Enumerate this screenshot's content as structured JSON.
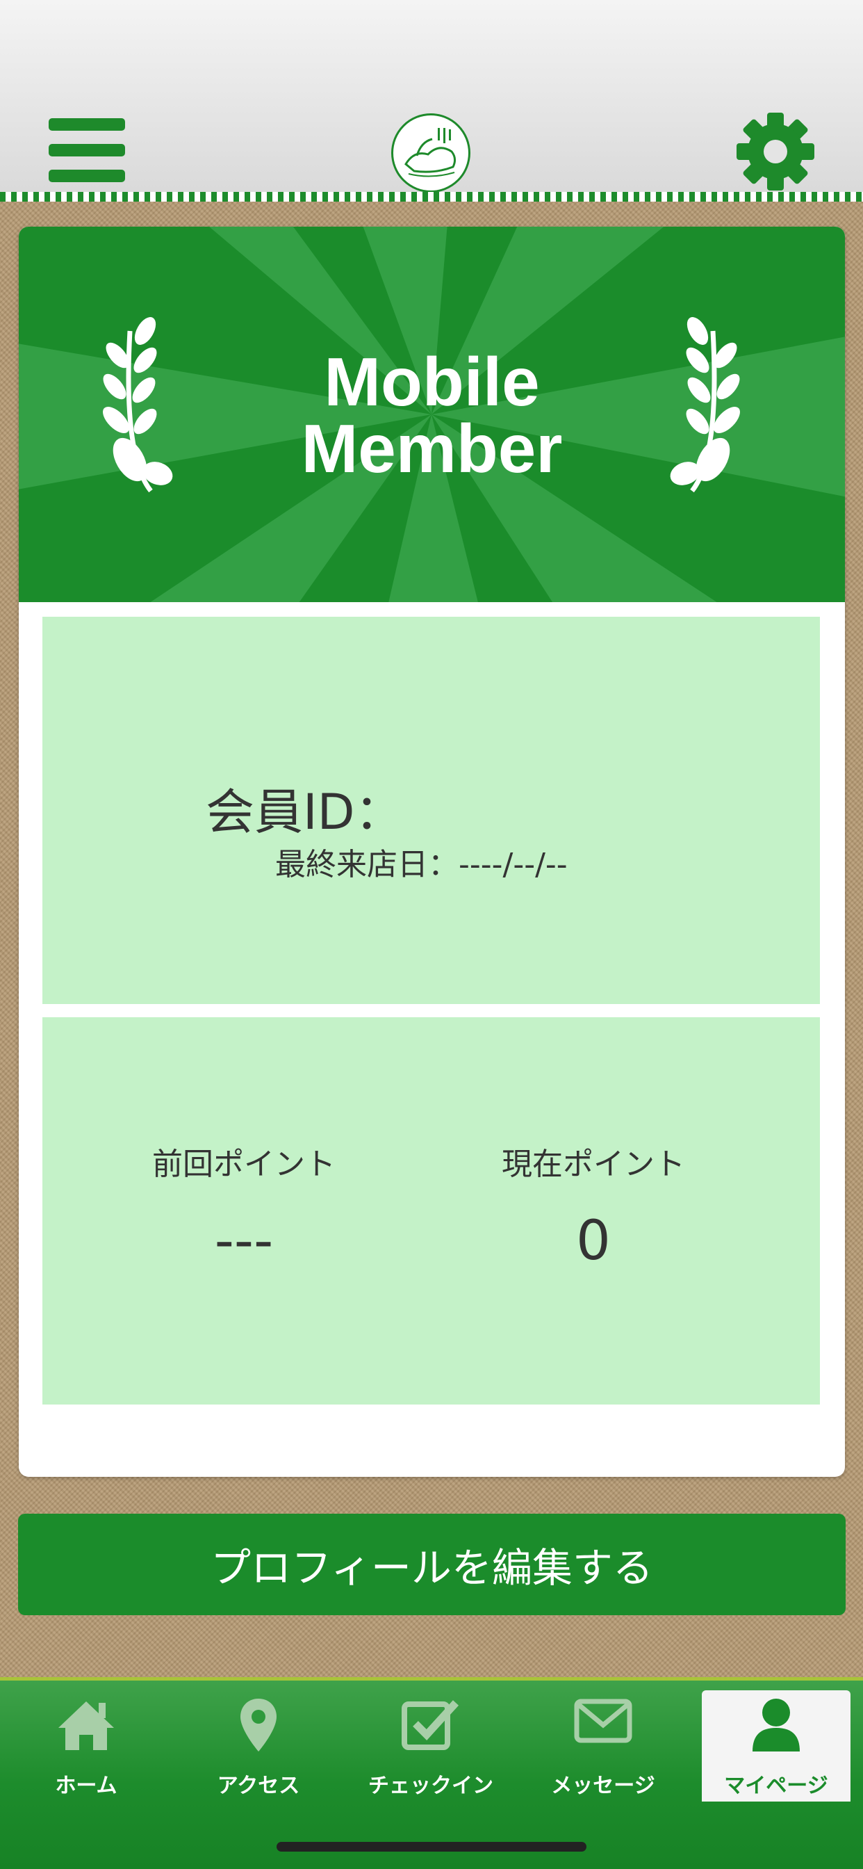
{
  "header": {
    "menu_icon": "hamburger-menu-icon",
    "logo_icon": "shop-logo",
    "settings_icon": "gear-icon",
    "brand_color": "#1e8a2b"
  },
  "card": {
    "banner_title_line1": "Mobile",
    "banner_title_line2": "Member",
    "member_id_label": "会員ID：",
    "last_visit_label": "最終来店日：----/--/--",
    "previous_points_label": "前回ポイント",
    "previous_points_value": "---",
    "current_points_label": "現在ポイント",
    "current_points_value": "0",
    "panel_color": "#c4f2c8"
  },
  "edit_profile_button": "プロフィールを編集する",
  "tabbar": {
    "active": "マイページ",
    "items": [
      {
        "label": "ホーム",
        "icon": "home-icon"
      },
      {
        "label": "アクセス",
        "icon": "location-pin-icon"
      },
      {
        "label": "チェックイン",
        "icon": "checkbox-icon"
      },
      {
        "label": "メッセージ",
        "icon": "envelope-icon"
      },
      {
        "label": "マイページ",
        "icon": "person-icon"
      }
    ]
  }
}
